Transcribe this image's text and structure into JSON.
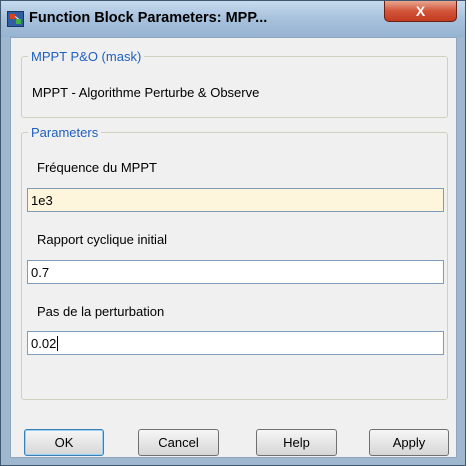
{
  "window": {
    "title": "Function Block Parameters: MPP...",
    "close_label": "X"
  },
  "mask": {
    "group_title": "MPPT P&O (mask)",
    "description": "MPPT - Algorithme Perturbe & Observe"
  },
  "parameters": {
    "group_title": "Parameters",
    "fields": [
      {
        "label": "Fréquence du MPPT",
        "value": "1e3"
      },
      {
        "label": "Rapport cyclique initial",
        "value": "0.7"
      },
      {
        "label": "Pas de la perturbation",
        "value": "0.02"
      }
    ]
  },
  "buttons": {
    "ok": "OK",
    "cancel": "Cancel",
    "help": "Help",
    "apply": "Apply"
  }
}
